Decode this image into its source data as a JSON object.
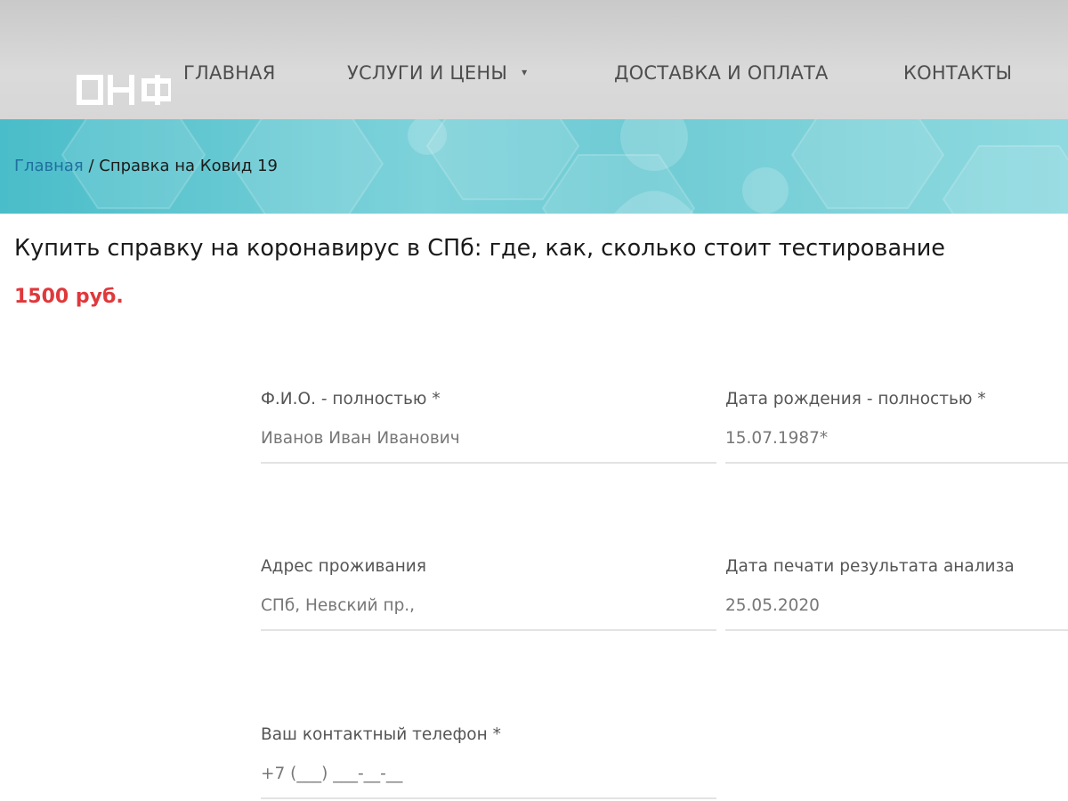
{
  "logo": {
    "text": "ОНФ",
    "color": "#ffffff"
  },
  "nav": {
    "items": [
      {
        "label": "ГЛАВНАЯ"
      },
      {
        "label": "УСЛУГИ И ЦЕНЫ",
        "has_dropdown": true,
        "caret": "▾"
      },
      {
        "label": "ДОСТАВКА И ОПЛАТА"
      },
      {
        "label": "КОНТАКТЫ"
      }
    ]
  },
  "breadcrumb": {
    "home": "Главная",
    "separator": " / ",
    "current": "Справка на Ковид 19"
  },
  "page": {
    "title": "Купить справку на коронавирус в СПб: где, как, сколько стоит тестирование",
    "price": "1500 руб."
  },
  "form": {
    "fio": {
      "label": "Ф.И.О. - полностью *",
      "value": "Иванов Иван Иванович"
    },
    "dob": {
      "label": "Дата рождения - полностью *",
      "value": "15.07.1987*"
    },
    "address": {
      "label": "Адрес проживания",
      "value": "СПб, Невский пр.,"
    },
    "print_date": {
      "label": "Дата печати результата анализа",
      "value": "25.05.2020"
    },
    "phone": {
      "label": "Ваш контактный телефон *",
      "value": "+7 (___) ___-__-__"
    }
  },
  "colors": {
    "nav_bg": "#d2d2d2",
    "banner": "#6fcbd4",
    "breadcrumb_link": "#1f6f9f",
    "price": "#e0383b"
  }
}
